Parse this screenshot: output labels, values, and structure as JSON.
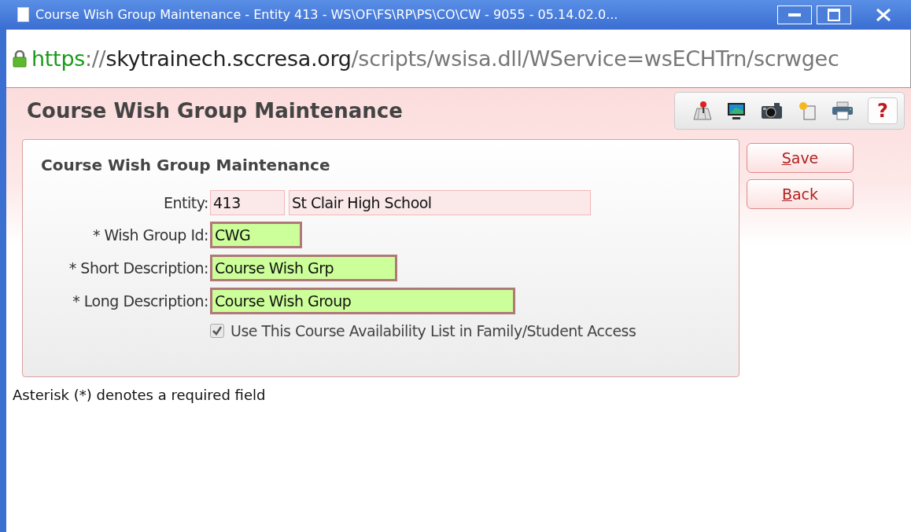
{
  "window": {
    "title": "Course Wish Group Maintenance - Entity 413 - WS\\OF\\FS\\RP\\PS\\CO\\CW - 9055 - 05.14.02.0..."
  },
  "address_bar": {
    "secure": true,
    "scheme": "https",
    "separator": "://",
    "host": "skytrainech.sccresa.org",
    "path": "/scripts/wsisa.dll/WService=wsECHTrn/scrwgec"
  },
  "page": {
    "title": "Course Wish Group Maintenance",
    "toolbar": [
      {
        "kind": "map"
      },
      {
        "kind": "monitor"
      },
      {
        "kind": "camera"
      },
      {
        "kind": "new-page"
      },
      {
        "kind": "print"
      },
      {
        "kind": "help",
        "label": "?"
      }
    ],
    "panel": {
      "title": "Course Wish Group Maintenance",
      "rows": [
        {
          "label": "Entity:",
          "fields": [
            {
              "kind": "readonly",
              "value": "413"
            },
            {
              "kind": "readonly",
              "value": "St Clair High School"
            }
          ]
        },
        {
          "label": "* Wish Group Id:",
          "fields": [
            {
              "kind": "required",
              "value": "CWG"
            }
          ]
        },
        {
          "label": "* Short Description:",
          "fields": [
            {
              "kind": "required",
              "value": "Course Wish Grp"
            }
          ]
        },
        {
          "label": "* Long Description:",
          "fields": [
            {
              "kind": "required",
              "value": "Course Wish Group"
            }
          ]
        }
      ],
      "checkbox": {
        "label": "Use This Course Availability List in Family/Student Access",
        "checked": true,
        "disabled": true
      }
    },
    "buttons": [
      {
        "label": "Save",
        "mnemonic": true
      },
      {
        "label": "Back",
        "mnemonic": true
      }
    ],
    "note": "Asterisk (*) denotes a required field"
  }
}
